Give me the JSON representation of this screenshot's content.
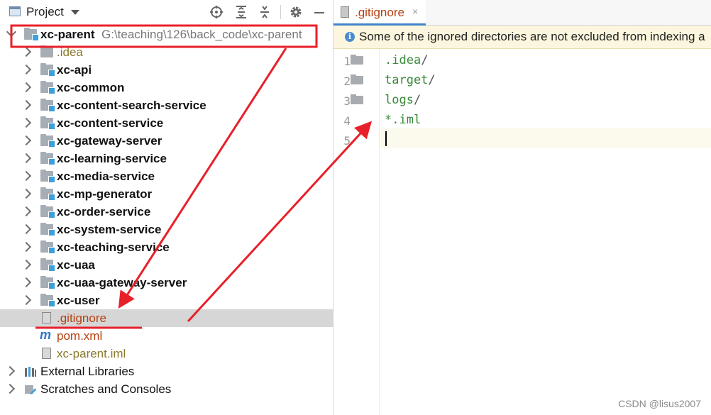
{
  "project_panel": {
    "title": "Project",
    "toolbar_icons": [
      "locate-icon",
      "expand-all-icon",
      "collapse-all-icon",
      "gear-icon",
      "minimize-icon"
    ],
    "root": {
      "name": "xc-parent",
      "path": "G:\\teaching\\126\\back_code\\xc-parent"
    },
    "items": [
      {
        "label": ".idea",
        "kind": "folder-plain",
        "style": "gold"
      },
      {
        "label": "xc-api",
        "kind": "module"
      },
      {
        "label": "xc-common",
        "kind": "module"
      },
      {
        "label": "xc-content-search-service",
        "kind": "module"
      },
      {
        "label": "xc-content-service",
        "kind": "module"
      },
      {
        "label": "xc-gateway-server",
        "kind": "module"
      },
      {
        "label": "xc-learning-service",
        "kind": "module"
      },
      {
        "label": "xc-media-service",
        "kind": "module"
      },
      {
        "label": "xc-mp-generator",
        "kind": "module"
      },
      {
        "label": "xc-order-service",
        "kind": "module"
      },
      {
        "label": "xc-system-service",
        "kind": "module"
      },
      {
        "label": "xc-teaching-service",
        "kind": "module"
      },
      {
        "label": "xc-uaa",
        "kind": "module"
      },
      {
        "label": "xc-uaa-gateway-server",
        "kind": "module"
      },
      {
        "label": "xc-user",
        "kind": "module"
      }
    ],
    "files": [
      {
        "label": ".gitignore",
        "selected": true
      },
      {
        "label": "pom.xml"
      },
      {
        "label": "xc-parent.iml"
      }
    ],
    "external_libraries": "External Libraries",
    "scratches": "Scratches and Consoles"
  },
  "editor": {
    "tab_label": ".gitignore",
    "tab_close": "×",
    "notification": "Some of the ignored directories are not excluded from indexing a",
    "lines": [
      {
        "num": "1",
        "text": ".idea",
        "slash": "/"
      },
      {
        "num": "2",
        "text": "target",
        "slash": "/"
      },
      {
        "num": "3",
        "text": "logs",
        "slash": "/"
      },
      {
        "num": "4",
        "text": "*.iml",
        "slash": ""
      },
      {
        "num": "5",
        "text": "",
        "slash": ""
      }
    ]
  },
  "watermark": "CSDN @lisus2007",
  "colors": {
    "annotation": "#e8202a",
    "tab_accent": "#4083c9",
    "gitignore_text": "#b7400f",
    "module_badge": "#3d9fdc"
  }
}
